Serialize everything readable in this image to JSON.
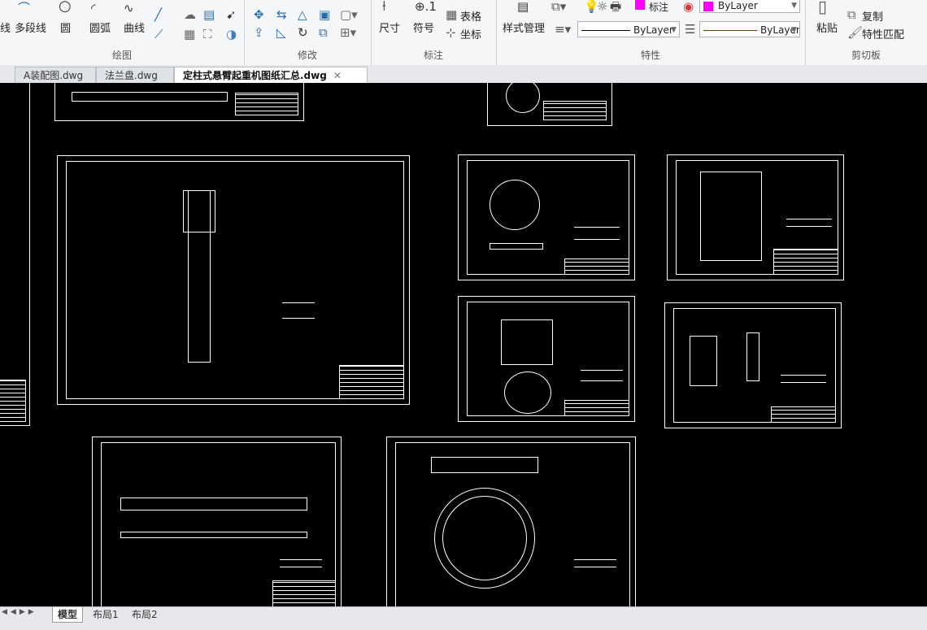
{
  "ribbon": {
    "draw": {
      "title": "绘图",
      "line_partial": "线",
      "polyline": "多段线",
      "circle": "圆",
      "arc": "圆弧",
      "spline": "曲线"
    },
    "modify": {
      "title": "修改"
    },
    "annotation": {
      "title": "标注",
      "dimension": "尺寸",
      "symbol": "符号",
      "table": "表格",
      "coordinate": "坐标"
    },
    "properties": {
      "title": "特性",
      "style_manager": "样式管理",
      "layer_partial": "标注",
      "color_value": "ByLayer",
      "linetype_value": "ByLayer",
      "lineweight_value": "ByLayer",
      "color_swatch": "#ff00ff",
      "lineweight_color": "#e00000"
    },
    "clipboard": {
      "title": "剪切板",
      "paste": "粘贴",
      "copy": "复制",
      "match_properties": "特性匹配"
    }
  },
  "tabs": [
    {
      "label": "A装配图.dwg"
    },
    {
      "label": "法兰盘.dwg"
    },
    {
      "label": "定柱式悬臂起重机图纸汇总.dwg",
      "close": "✕"
    }
  ],
  "layout_tabs": [
    {
      "label": "模型"
    },
    {
      "label": "布局1"
    },
    {
      "label": "布局2"
    }
  ]
}
